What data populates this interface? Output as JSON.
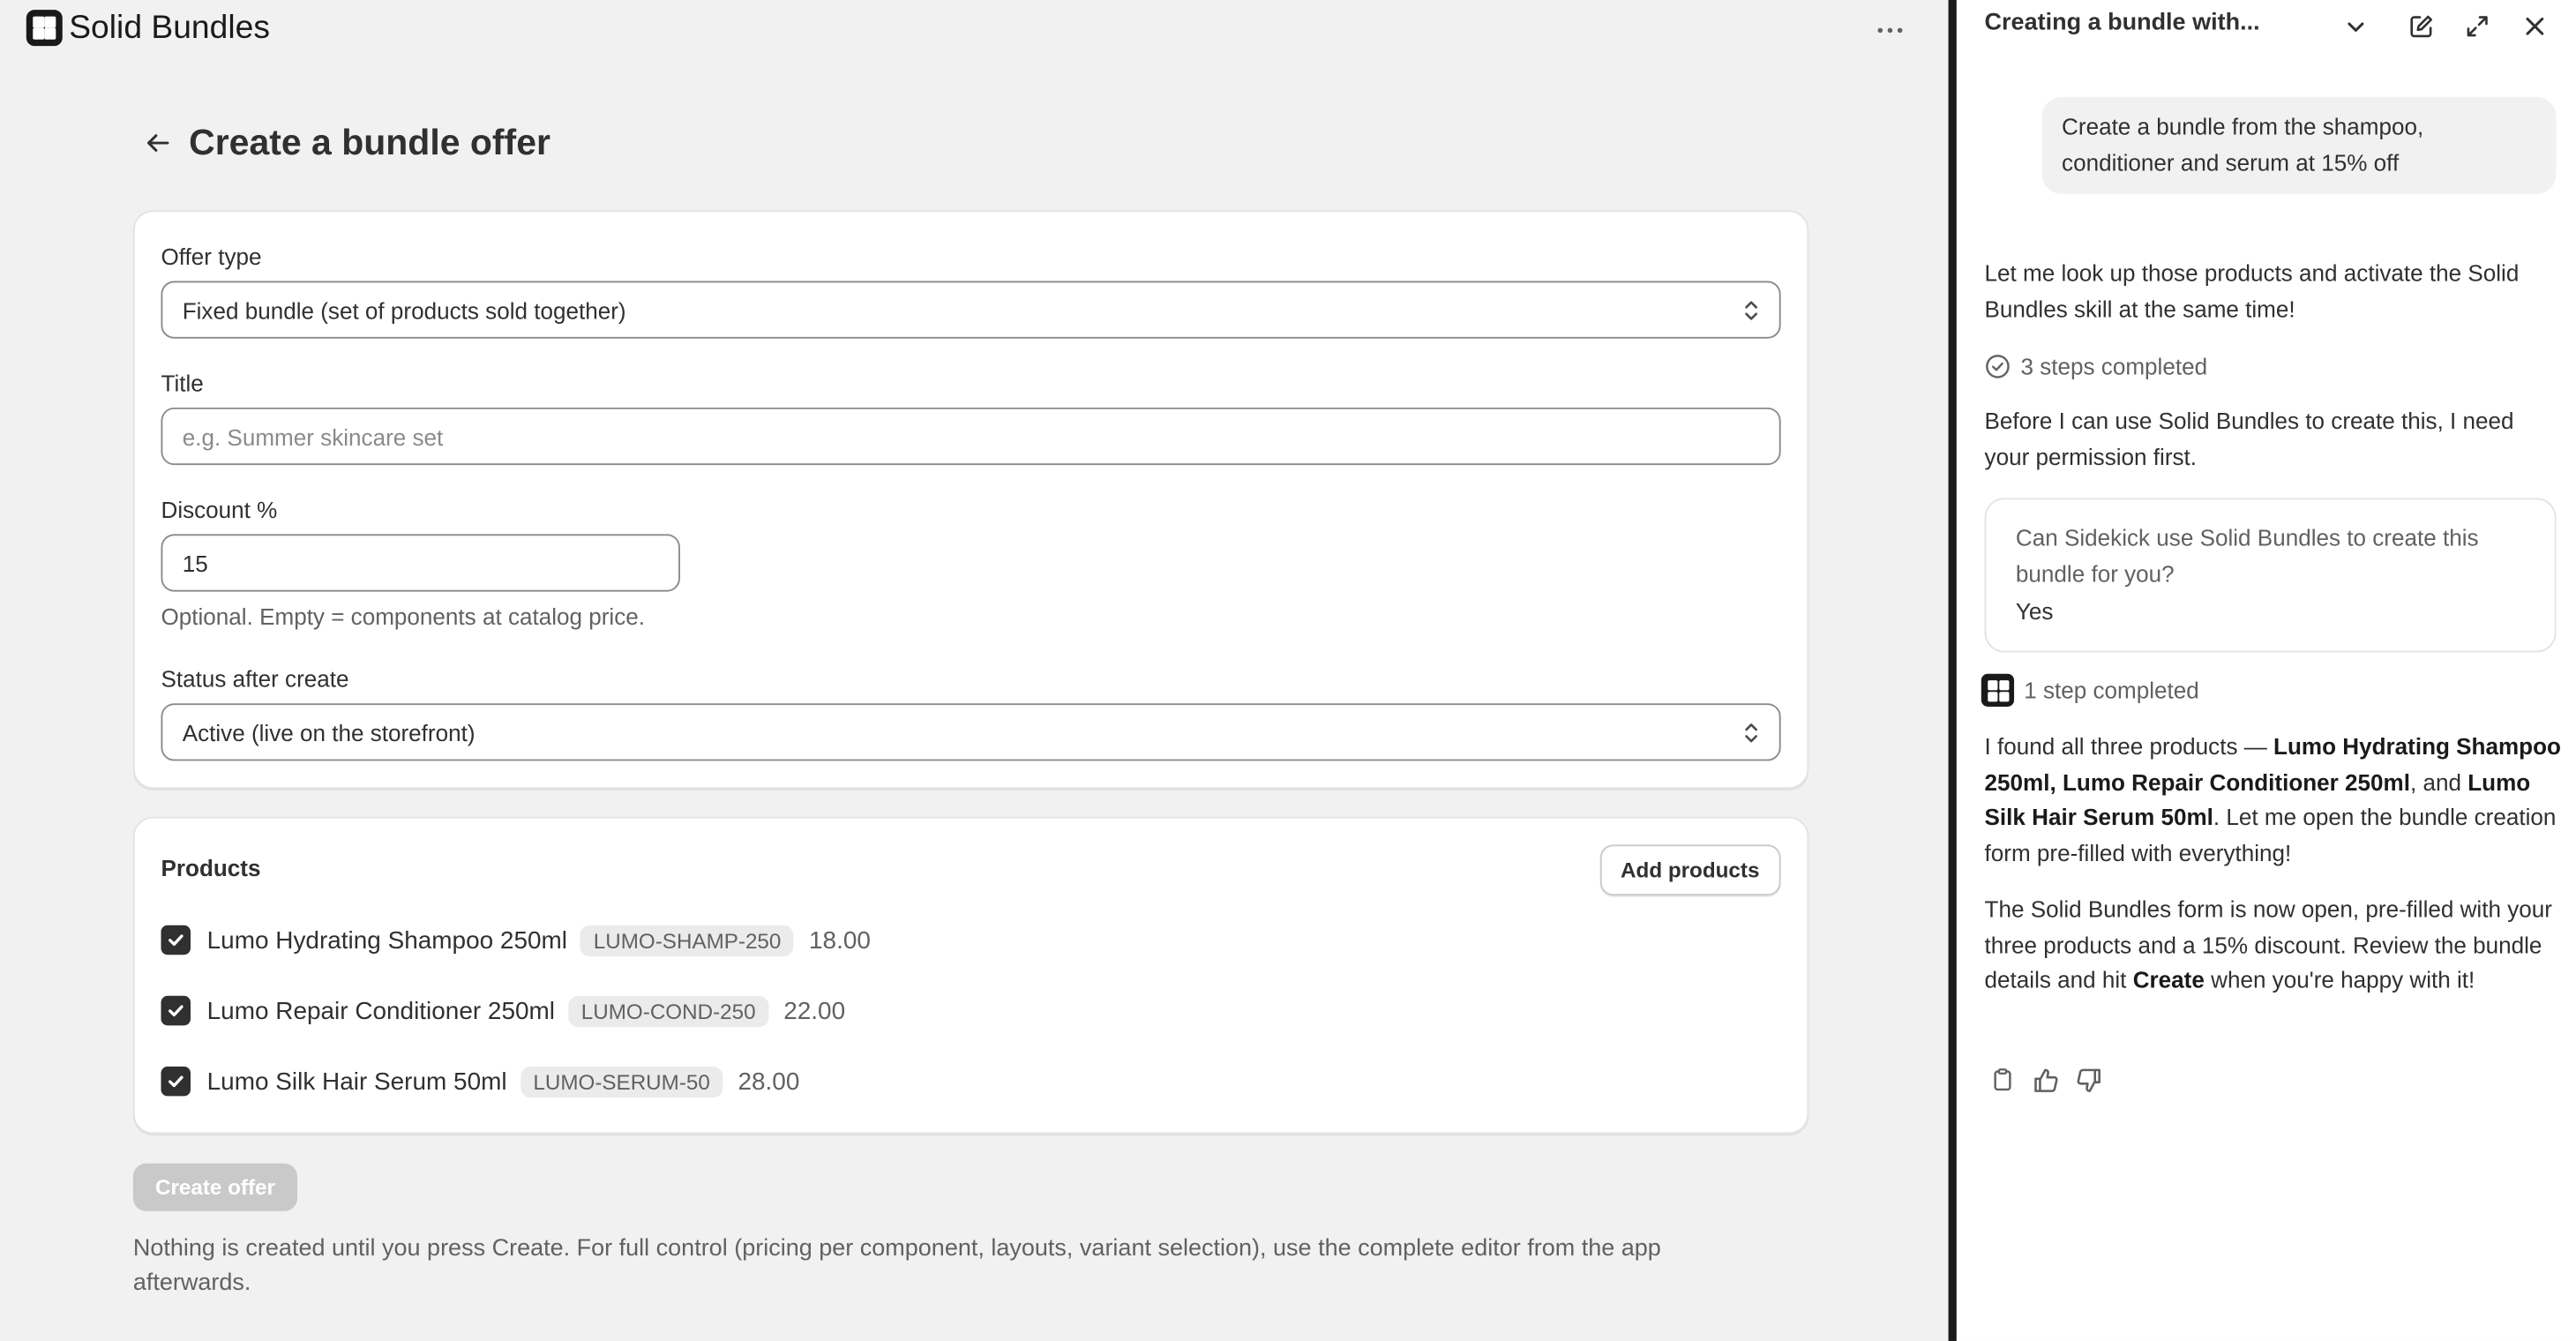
{
  "app": {
    "name": "Solid Bundles",
    "more_icon": "more-horizontal-icon"
  },
  "page": {
    "title": "Create a bundle offer",
    "back_icon": "arrow-left-icon"
  },
  "form": {
    "offer_type": {
      "label": "Offer type",
      "value": "Fixed bundle (set of products sold together)"
    },
    "title": {
      "label": "Title",
      "placeholder": "e.g. Summer skincare set",
      "value": ""
    },
    "discount": {
      "label": "Discount %",
      "value": "15",
      "help": "Optional. Empty = components at catalog price."
    },
    "status": {
      "label": "Status after create",
      "value": "Active (live on the storefront)"
    }
  },
  "products": {
    "title": "Products",
    "add_label": "Add products",
    "items": [
      {
        "name": "Lumo Hydrating Shampoo 250ml",
        "sku": "LUMO-SHAMP-250",
        "price": "18.00",
        "checked": true
      },
      {
        "name": "Lumo Repair Conditioner 250ml",
        "sku": "LUMO-COND-250",
        "price": "22.00",
        "checked": true
      },
      {
        "name": "Lumo Silk Hair Serum 50ml",
        "sku": "LUMO-SERUM-50",
        "price": "28.00",
        "checked": true
      }
    ]
  },
  "actions": {
    "create_label": "Create offer",
    "note": "Nothing is created until you press Create. For full control (pricing per component, layouts, variant selection), use the complete editor from the app afterwards."
  },
  "sidekick": {
    "title": "Creating a bundle with...",
    "user_message": "Create a bundle from the shampoo, conditioner and serum at 15% off",
    "msg1": "Let me look up those products and activate the Solid Bundles skill at the same time!",
    "steps1": "3 steps completed",
    "msg2": "Before I can use Solid Bundles to create this, I need your permission first.",
    "permission_question": "Can Sidekick use Solid Bundles to create this bundle for you?",
    "permission_answer": "Yes",
    "steps2": "1 step completed",
    "msg3_parts": {
      "a": "I found all three products — ",
      "p1": "Lumo Hydrating Shampoo 250ml",
      "sep1": ", ",
      "p2": "Lumo Repair Conditioner 250ml",
      "sep2": ", and ",
      "p3": "Lumo Silk Hair Serum 50ml",
      "b": ". Let me open the bundle creation form pre-filled with everything!"
    },
    "msg4_parts": {
      "a": "The Solid Bundles form is now open, pre-filled with your three products and a 15% discount. Review the bundle details and hit ",
      "bold": "Create",
      "b": " when you're happy with it!"
    }
  },
  "colors": {
    "background": "#f1f1f1",
    "card": "#ffffff",
    "text": "#303030",
    "muted": "#616161",
    "disabled_button": "#c9c9c9",
    "divider": "#1a1a1a"
  }
}
